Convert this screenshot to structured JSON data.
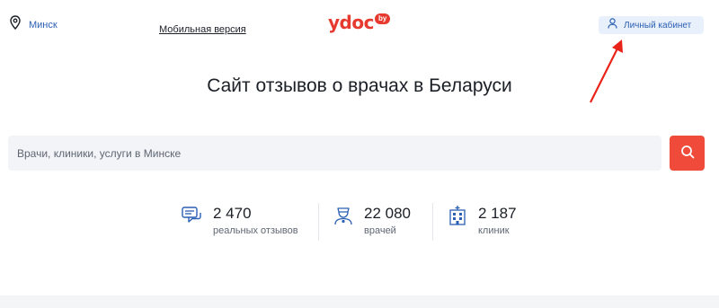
{
  "header": {
    "city": "Минск",
    "mobile_link": "Мобильная версия",
    "logo_text": "ydoc",
    "logo_badge": "by",
    "cabinet_label": "Личный кабинет"
  },
  "main": {
    "title": "Сайт отзывов о врачах в Беларуси",
    "search_placeholder": "Врачи, клиники, услуги в Минске"
  },
  "stats": [
    {
      "value": "2 470",
      "label": "реальных отзывов",
      "icon": "reviews-icon"
    },
    {
      "value": "22 080",
      "label": "врачей",
      "icon": "doctor-icon"
    },
    {
      "value": "2 187",
      "label": "клиник",
      "icon": "clinic-icon"
    }
  ],
  "colors": {
    "brand_red": "#e63a2e",
    "link_blue": "#2b5fb3",
    "search_button": "#f04a3a",
    "cabinet_bg": "#e8f0fb"
  }
}
